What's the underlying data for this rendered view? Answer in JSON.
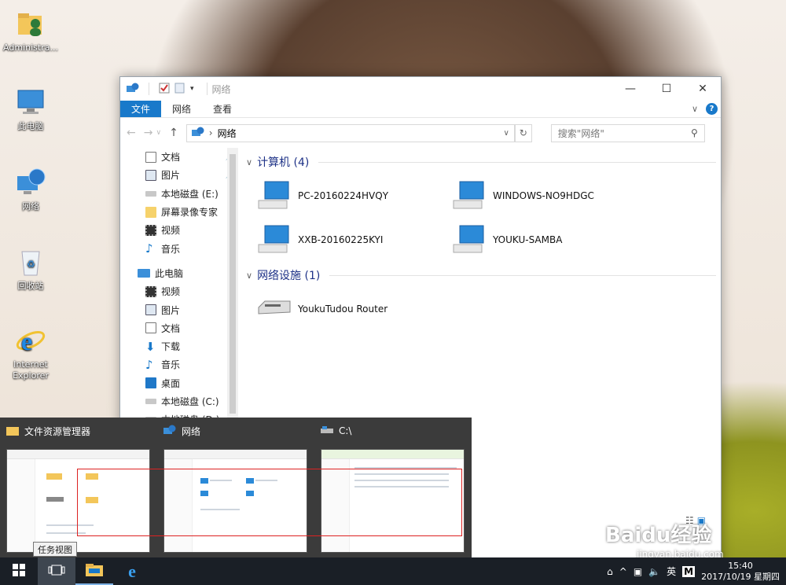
{
  "desktop": {
    "icons": [
      {
        "label": "Administra..."
      },
      {
        "label": "此电脑"
      },
      {
        "label": "网络"
      },
      {
        "label": "回收站"
      },
      {
        "label": "Internet Explorer"
      }
    ]
  },
  "explorer": {
    "title": "网络",
    "ribbon_tabs": [
      "文件",
      "网络",
      "查看"
    ],
    "address": "网络",
    "search_placeholder": "搜索\"网络\"",
    "sidebar": [
      {
        "label": "文档",
        "pinned": true
      },
      {
        "label": "图片",
        "pinned": true
      },
      {
        "label": "本地磁盘 (E:)"
      },
      {
        "label": "屏幕录像专家"
      },
      {
        "label": "视频"
      },
      {
        "label": "音乐"
      },
      {
        "label": "此电脑"
      },
      {
        "label": "视频"
      },
      {
        "label": "图片"
      },
      {
        "label": "文档"
      },
      {
        "label": "下载"
      },
      {
        "label": "音乐"
      },
      {
        "label": "桌面"
      },
      {
        "label": "本地磁盘 (C:)"
      },
      {
        "label": "本地磁盘 (D:)"
      }
    ],
    "groups": [
      {
        "header": "计算机 (4)",
        "items": [
          "PC-20160224HVQY",
          "WINDOWS-NO9HDGC",
          "XXB-20160225KYI",
          "YOUKU-SAMBA"
        ]
      },
      {
        "header": "网络设施 (1)",
        "items": [
          "YoukuTudou Router"
        ]
      }
    ]
  },
  "thumbnails": [
    {
      "title": "文件资源管理器"
    },
    {
      "title": "网络"
    },
    {
      "title": "C:\\"
    }
  ],
  "tooltip": "任务视图",
  "taskbar": {
    "ime": "英",
    "ime_mode": "M",
    "time": "15:40",
    "date": "2017/10/19 星期四"
  },
  "watermark": {
    "logo": "Baidu经验",
    "url": "jingyan.baidu.com"
  },
  "colors": {
    "accent": "#1979ca",
    "group_header": "#1e3287",
    "taskbar": "#1a1f26",
    "annotation": "#dd2222"
  }
}
